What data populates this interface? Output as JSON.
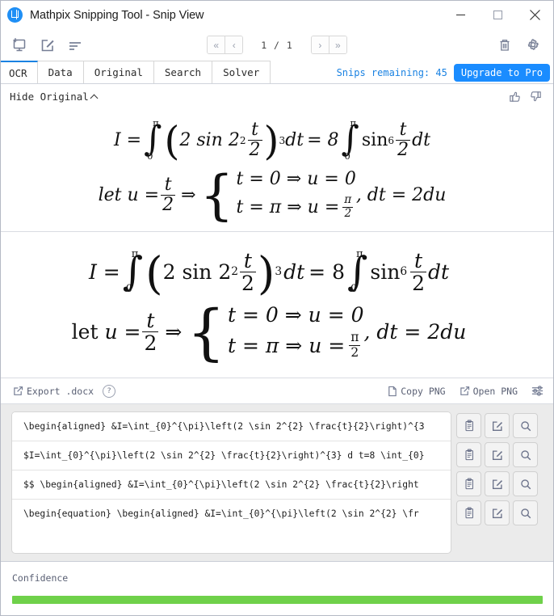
{
  "window": {
    "title": "Mathpix Snipping Tool - Snip View",
    "logo_icon": "mathpix-logo-icon",
    "controls": [
      {
        "name": "minimize",
        "icon": "minimize-icon"
      },
      {
        "name": "maximize",
        "icon": "maximize-icon"
      },
      {
        "name": "close",
        "icon": "close-icon"
      }
    ]
  },
  "toolbar": {
    "left_icons": [
      {
        "name": "new-snip",
        "icon": "snip-screen-icon"
      },
      {
        "name": "edit-snip",
        "icon": "edit-square-icon"
      },
      {
        "name": "list-view",
        "icon": "list-lines-icon"
      }
    ],
    "pager": {
      "first_label": "«",
      "prev_label": "‹",
      "page_label": "1 / 1",
      "next_label": "›",
      "last_label": "»"
    },
    "right_icons": [
      {
        "name": "delete-snip",
        "icon": "trash-icon"
      },
      {
        "name": "settings",
        "icon": "gear-icon"
      }
    ]
  },
  "tabs": {
    "items": [
      {
        "label": "OCR",
        "active": true
      },
      {
        "label": "Data",
        "active": false
      },
      {
        "label": "Original",
        "active": false
      },
      {
        "label": "Search",
        "active": false
      },
      {
        "label": "Solver",
        "active": false
      }
    ],
    "snips_remaining_label": "Snips remaining: 45",
    "upgrade_label": "Upgrade to Pro",
    "accent_color": "#1a8cff",
    "link_color": "#1a82e2"
  },
  "original_panel": {
    "toggle_label": "Hide Original",
    "toggle_icon": "chevron-up-icon",
    "thumbs_up_icon": "thumbs-up-icon",
    "thumbs_down_icon": "thumbs-down-icon"
  },
  "equation": {
    "line1": {
      "lhs": "I =",
      "int1_lower": "0",
      "int1_upper": "π",
      "inner": "2 sin 2",
      "inner_sup": "2",
      "frac_num": "t",
      "frac_den": "2",
      "paren_sup": "3",
      "dt": "dt",
      "eq8": "= 8",
      "int2_lower": "0",
      "int2_upper": "π",
      "sin": "sin",
      "sin_sup": "6",
      "frac2_num": "t",
      "frac2_den": "2",
      "dt2": "dt"
    },
    "line2": {
      "let": "let",
      "u": "u =",
      "frac_num": "t",
      "frac_den": "2",
      "implies": "⇒",
      "case1": "t = 0 ⇒ u = 0",
      "case2_pre": "t = π ⇒ u =",
      "case2_frac_num": "π",
      "case2_frac_den": "2",
      "tail": ", dt = 2du"
    }
  },
  "export_row": {
    "export_label": "Export .docx",
    "export_icon": "external-link-icon",
    "help_icon": "help-circle-icon",
    "help_label": "?",
    "copy_png_label": "Copy PNG",
    "copy_png_icon": "copy-file-icon",
    "open_png_label": "Open PNG",
    "open_png_icon": "external-link-icon",
    "options_icon": "sliders-icon"
  },
  "results": {
    "rows": [
      {
        "latex": "\\begin{aligned} &I=\\int_{0}^{\\pi}\\left(2 \\sin 2^{2} \\frac{t}{2}\\right)^{3",
        "actions": [
          {
            "name": "copy-button",
            "icon": "clipboard-icon"
          },
          {
            "name": "edit-button",
            "icon": "edit-square-icon"
          },
          {
            "name": "preview-button",
            "icon": "magnifier-icon"
          }
        ]
      },
      {
        "latex": "$I=\\int_{0}^{\\pi}\\left(2 \\sin 2^{2} \\frac{t}{2}\\right)^{3} d t=8 \\int_{0}",
        "actions": [
          {
            "name": "copy-button",
            "icon": "clipboard-icon"
          },
          {
            "name": "edit-button",
            "icon": "edit-square-icon"
          },
          {
            "name": "preview-button",
            "icon": "magnifier-icon"
          }
        ]
      },
      {
        "latex": "$$  \\begin{aligned} &I=\\int_{0}^{\\pi}\\left(2 \\sin 2^{2} \\frac{t}{2}\\right",
        "actions": [
          {
            "name": "copy-button",
            "icon": "clipboard-icon"
          },
          {
            "name": "edit-button",
            "icon": "edit-square-icon"
          },
          {
            "name": "preview-button",
            "icon": "magnifier-icon"
          }
        ]
      },
      {
        "latex": "\\begin{equation}  \\begin{aligned} &I=\\int_{0}^{\\pi}\\left(2 \\sin 2^{2} \\fr",
        "actions": [
          {
            "name": "copy-button",
            "icon": "clipboard-icon"
          },
          {
            "name": "edit-button",
            "icon": "edit-square-icon"
          },
          {
            "name": "preview-button",
            "icon": "magnifier-icon"
          }
        ]
      }
    ]
  },
  "confidence": {
    "label": "Confidence",
    "value_percent": 100,
    "bar_color": "#6fd14a"
  }
}
